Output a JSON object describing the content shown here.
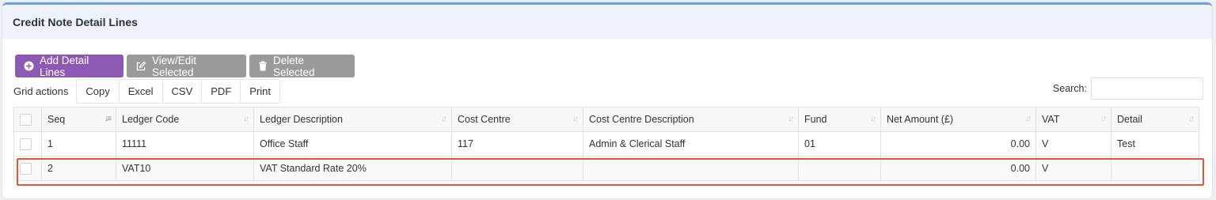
{
  "card": {
    "title": "Credit Note Detail Lines"
  },
  "toolbar": {
    "add_label": "Add Detail Lines",
    "view_label": "View/Edit Selected",
    "delete_label": "Delete Selected"
  },
  "grid_actions": {
    "label": "Grid actions",
    "buttons": [
      "Copy",
      "Excel",
      "CSV",
      "PDF",
      "Print"
    ]
  },
  "search": {
    "label": "Search:",
    "value": ""
  },
  "table": {
    "columns": [
      "Seq",
      "Ledger Code",
      "Ledger Description",
      "Cost Centre",
      "Cost Centre Description",
      "Fund",
      "Net Amount (£)",
      "VAT",
      "Detail"
    ],
    "rows": [
      {
        "seq": "1",
        "ledger_code": "11111",
        "ledger_description": "Office Staff",
        "cost_centre": "117",
        "cost_centre_description": "Admin & Clerical Staff",
        "fund": "01",
        "net_amount": "0.00",
        "vat": "V",
        "detail": "Test"
      },
      {
        "seq": "2",
        "ledger_code": "VAT10",
        "ledger_description": "VAT Standard Rate 20%",
        "cost_centre": "",
        "cost_centre_description": "",
        "fund": "",
        "net_amount": "0.00",
        "vat": "V",
        "detail": ""
      }
    ]
  },
  "colors": {
    "accent": "#8e59b5",
    "header_bar": "#6f9fe8",
    "highlight": "#e4543b"
  }
}
